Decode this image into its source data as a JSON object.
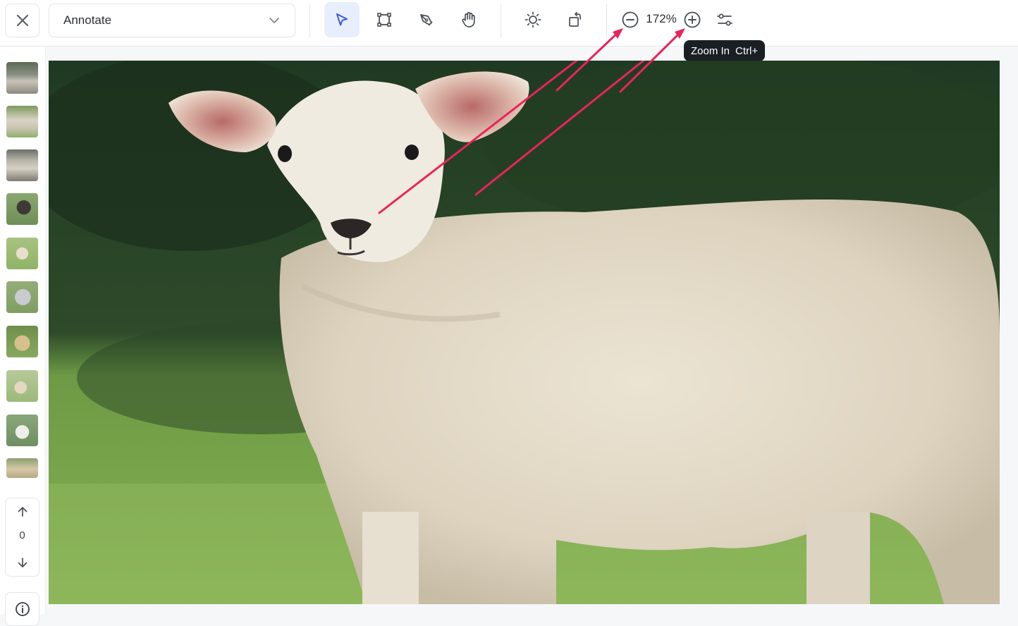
{
  "toolbar": {
    "mode_label": "Annotate",
    "zoom_value": "172%",
    "close_icon": "close-icon",
    "dropdown_icon": "chevron-down-icon",
    "tools": [
      "select-arrow-icon",
      "bounding-box-icon",
      "pen-icon",
      "hand-pan-icon",
      "brightness-icon",
      "rotate-icon"
    ],
    "zoom_out_icon": "zoom-out-icon",
    "zoom_in_icon": "zoom-in-icon",
    "settings_icon": "sliders-icon",
    "accent_color": "#3b5bdb"
  },
  "tooltip": {
    "label": "Zoom In",
    "shortcut": "Ctrl+"
  },
  "sidebar": {
    "thumbnails": [
      "sheep-thumbnail",
      "sheep-thumbnail",
      "sheep-thumbnail",
      "sheep-thumbnail",
      "sheep-thumbnail",
      "sheep-thumbnail",
      "sheep-thumbnail",
      "sheep-thumbnail",
      "sheep-thumbnail",
      "sheep-thumbnail"
    ],
    "pager_count": "0",
    "up_icon": "arrow-up-icon",
    "down_icon": "arrow-down-icon",
    "info_icon": "info-icon"
  },
  "canvas": {
    "image_subject": "lamb-in-grass-photo",
    "annotation_color": "#e8245c"
  }
}
